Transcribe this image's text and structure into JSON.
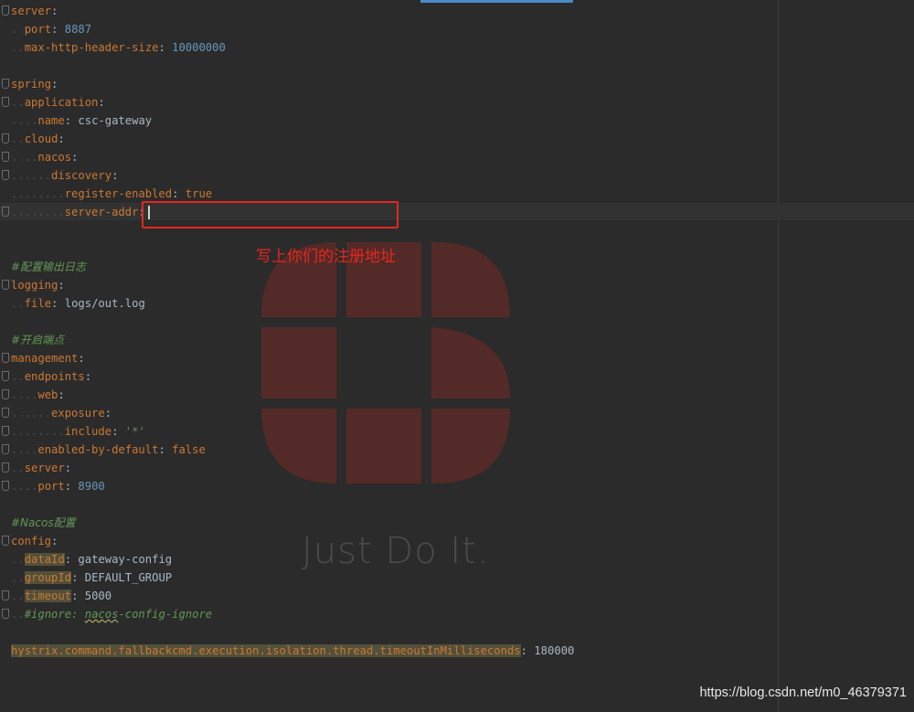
{
  "annotation": "写上你们的注册地址",
  "watermark_text": "Just Do It.",
  "csdn_watermark": "https://blog.csdn.net/m0_46379371",
  "code": {
    "server_key": "server",
    "port_key": "port",
    "port_val": "8887",
    "mhhs_key": "max-http-header-size",
    "mhhs_val": "10000000",
    "spring_key": "spring",
    "application_key": "application",
    "name_key": "name",
    "name_val": "csc-gateway",
    "cloud_key": "cloud",
    "nacos_key": "nacos",
    "discovery_key": "discovery",
    "register_key": "register-enabled",
    "register_val": "true",
    "server_addr_key": "server-addr",
    "comment_logging": "#配置输出日志",
    "logging_key": "logging",
    "file_key": "file",
    "file_val": "logs/out.log",
    "comment_endpoint": "#开启端点",
    "management_key": "management",
    "endpoints_key": "endpoints",
    "web_key": "web",
    "exposure_key": "exposure",
    "include_key": "include",
    "include_val": "'*'",
    "enabled_key": "enabled-by-default",
    "enabled_val": "false",
    "server2_key": "server",
    "port2_key": "port",
    "port2_val": "8900",
    "comment_nacos": "#Nacos配置",
    "config_key": "config",
    "dataId_key": "dataId",
    "dataId_val": "gateway-config",
    "groupId_key": "groupId",
    "groupId_val": "DEFAULT_GROUP",
    "timeout_key": "timeout",
    "timeout_val": "5000",
    "ignore_comment_prefix": "#ignore: ",
    "ignore_comment_word": "nacos",
    "ignore_comment_suffix": "-config-ignore",
    "hystrix_key": "hystrix.command.fallbackcmd.execution.isolation.thread.timeoutInMilliseconds",
    "hystrix_val": "180000"
  },
  "colors": {
    "background": "#2b2b2b",
    "key": "#cc7832",
    "number": "#6897bb",
    "comment": "#629755",
    "annotation_red": "#e6261f"
  }
}
